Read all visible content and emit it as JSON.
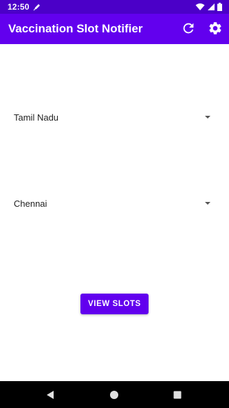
{
  "status_bar": {
    "time": "12:50",
    "icons": [
      "pen-icon",
      "wifi-icon",
      "signal-icon",
      "battery-icon"
    ],
    "color": "#4b00c8"
  },
  "app_bar": {
    "title": "Vaccination Slot Notifier",
    "actions": [
      "refresh-icon",
      "settings-icon"
    ],
    "color": "#6200ee"
  },
  "form": {
    "state_spinner": {
      "selected": "Tamil Nadu"
    },
    "city_spinner": {
      "selected": "Chennai"
    },
    "view_slots_label": "VIEW SLOTS"
  },
  "nav_bar": {
    "buttons": [
      "back-icon",
      "home-icon",
      "recents-icon"
    ]
  },
  "colors": {
    "primary": "#6200ee",
    "primary_dark": "#4b00c8",
    "text": "#222222"
  }
}
